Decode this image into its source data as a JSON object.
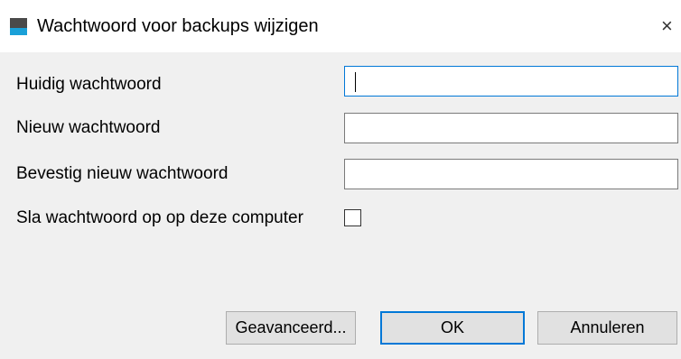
{
  "window": {
    "title": "Wachtwoord voor backups wijzigen",
    "close_glyph": "×",
    "icon": "app-icon"
  },
  "form": {
    "current_password_label": "Huidig wachtwoord",
    "current_password_value": "",
    "new_password_label": "Nieuw wachtwoord",
    "new_password_value": "",
    "confirm_password_label": "Bevestig nieuw wachtwoord",
    "confirm_password_value": "",
    "save_password_label": "Sla wachtwoord op op deze computer",
    "save_password_checked": false
  },
  "buttons": {
    "advanced": "Geavanceerd...",
    "ok": "OK",
    "cancel": "Annuleren"
  },
  "colors": {
    "accent": "#0078d7",
    "icon_dark": "#4a4a4a",
    "icon_blue": "#1aa0d8"
  }
}
